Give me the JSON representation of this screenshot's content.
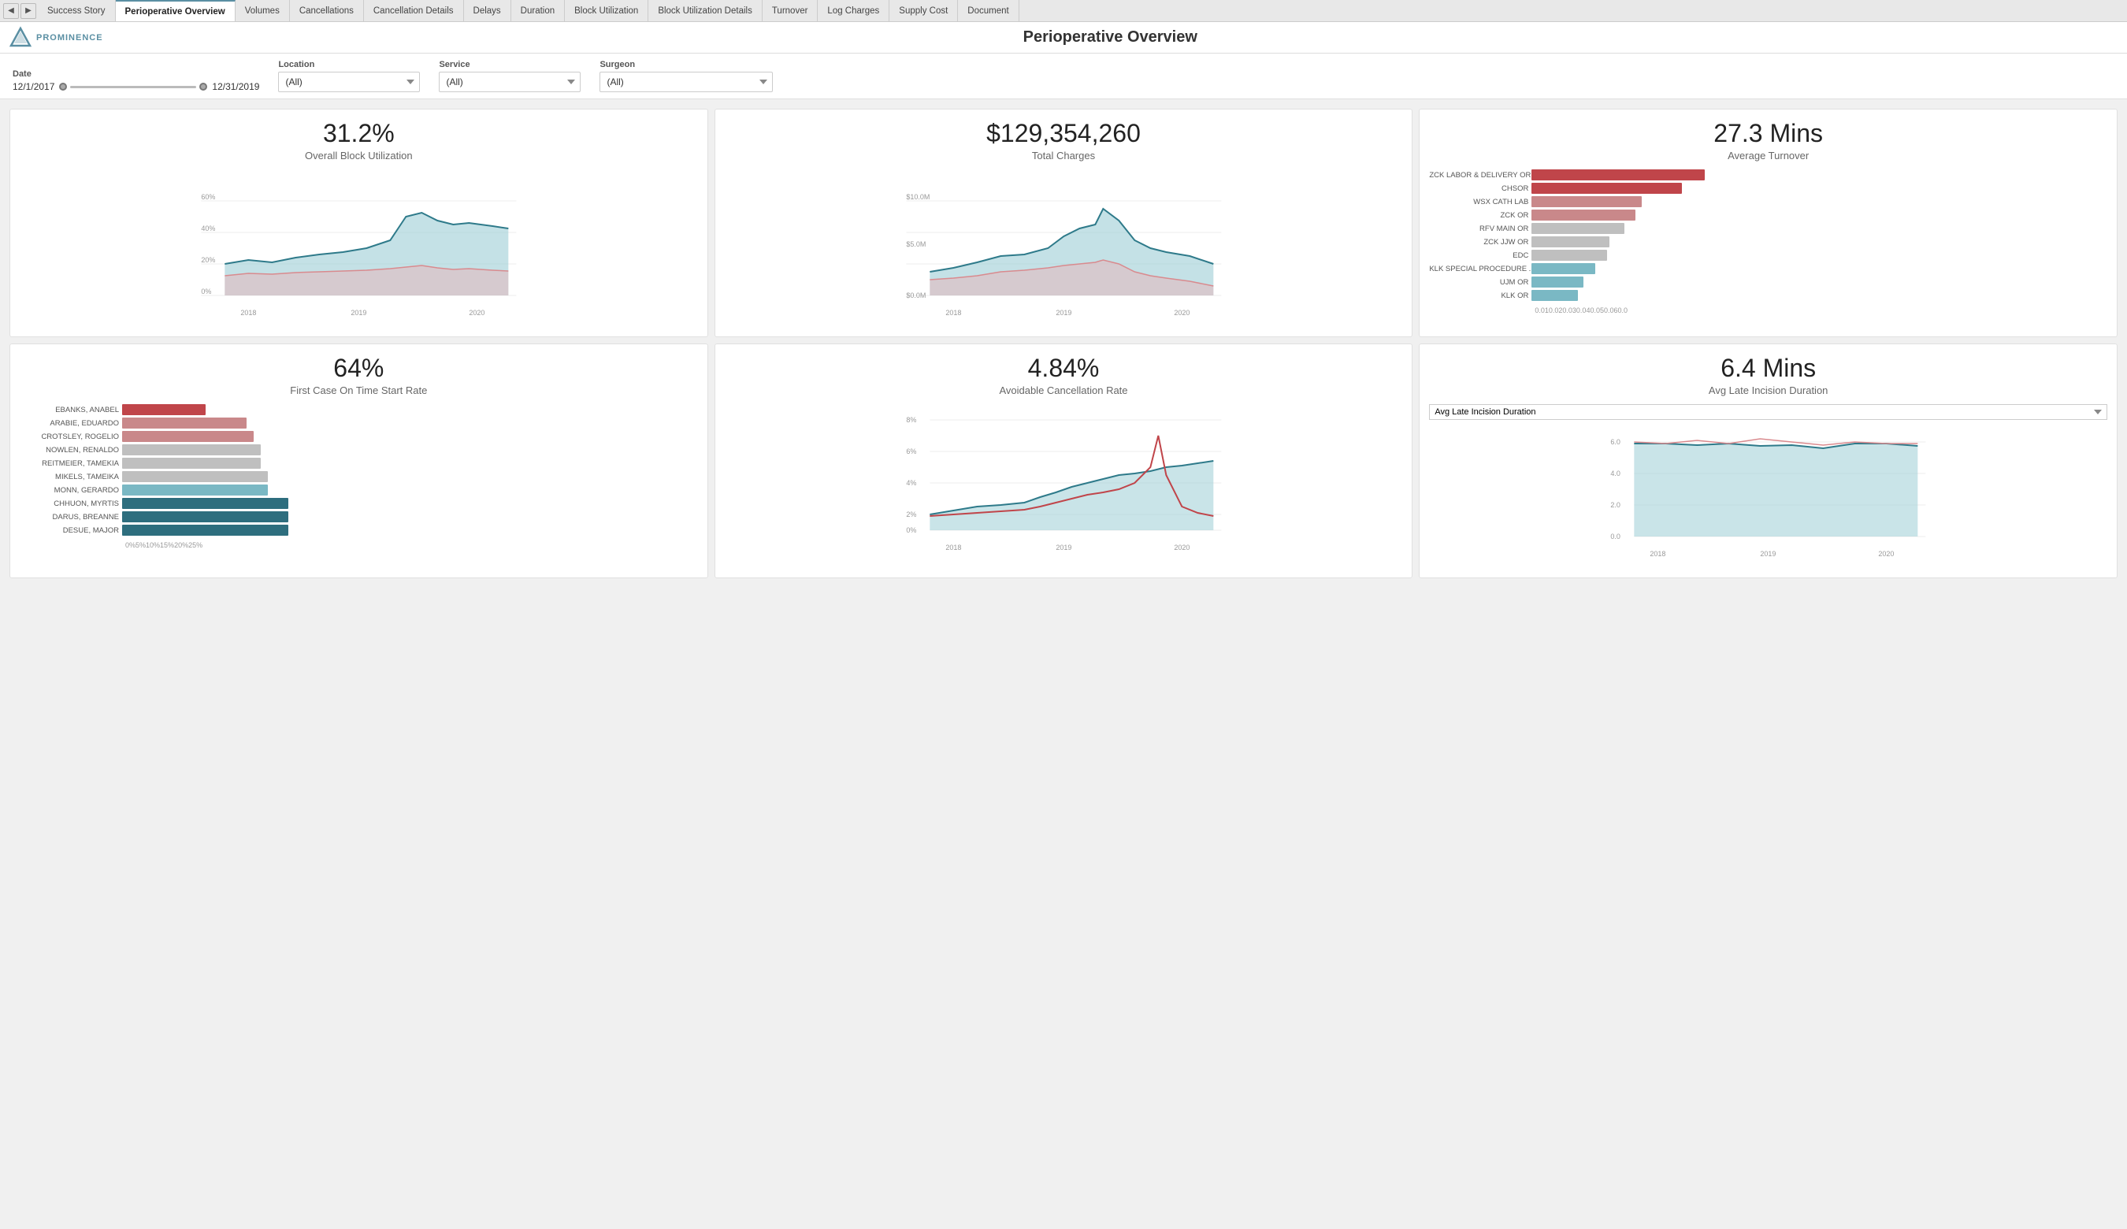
{
  "tabs": {
    "nav_prev": "<",
    "nav_next": ">",
    "items": [
      {
        "label": "Success Story",
        "active": false
      },
      {
        "label": "Perioperative Overview",
        "active": true
      },
      {
        "label": "Volumes",
        "active": false
      },
      {
        "label": "Cancellations",
        "active": false
      },
      {
        "label": "Cancellation Details",
        "active": false
      },
      {
        "label": "Delays",
        "active": false
      },
      {
        "label": "Duration",
        "active": false
      },
      {
        "label": "Block Utilization",
        "active": false
      },
      {
        "label": "Block Utilization Details",
        "active": false
      },
      {
        "label": "Turnover",
        "active": false
      },
      {
        "label": "Log Charges",
        "active": false
      },
      {
        "label": "Supply Cost",
        "active": false
      },
      {
        "label": "Document",
        "active": false
      }
    ]
  },
  "header": {
    "logo_text": "PROMINENCE",
    "title": "Perioperative Overview"
  },
  "filters": {
    "date_label": "Date",
    "date_start": "12/1/2017",
    "date_end": "12/31/2019",
    "location_label": "Location",
    "location_value": "(All)",
    "service_label": "Service",
    "service_value": "(All)",
    "surgeon_label": "Surgeon",
    "surgeon_value": "(All)"
  },
  "kpi1": {
    "value": "31.2%",
    "label": "Overall Block Utilization",
    "x_labels": [
      "2018",
      "2019",
      "2020"
    ]
  },
  "kpi2": {
    "value": "$129,354,260",
    "label": "Total Charges",
    "y_labels": [
      "$10.0M",
      "$5.0M",
      "$0.0M"
    ],
    "x_labels": [
      "2018",
      "2019",
      "2020"
    ]
  },
  "kpi3": {
    "value": "27.3 Mins",
    "label": "Average Turnover",
    "bars": [
      {
        "label": "ZCK LABOR & DELIVERY OR",
        "value": 60,
        "color": "#c0454a"
      },
      {
        "label": "CHSOR",
        "value": 52,
        "color": "#c0454a"
      },
      {
        "label": "WSX CATH LAB",
        "value": 38,
        "color": "#c9888a"
      },
      {
        "label": "ZCK OR",
        "value": 36,
        "color": "#c9888a"
      },
      {
        "label": "RFV MAIN OR",
        "value": 32,
        "color": "#bfbfbf"
      },
      {
        "label": "ZCK JJW OR",
        "value": 27,
        "color": "#bfbfbf"
      },
      {
        "label": "EDC",
        "value": 26,
        "color": "#bfbfbf"
      },
      {
        "label": "KLK SPECIAL PROCEDURE ...",
        "value": 22,
        "color": "#7ab8c4"
      },
      {
        "label": "UJM OR",
        "value": 18,
        "color": "#7ab8c4"
      },
      {
        "label": "KLK OR",
        "value": 16,
        "color": "#7ab8c4"
      }
    ],
    "x_labels": [
      "0.0",
      "10.0",
      "20.0",
      "30.0",
      "40.0",
      "50.0",
      "60.0"
    ],
    "max": 60
  },
  "kpi4": {
    "value": "64%",
    "label": "First Case On Time Start Rate",
    "bars": [
      {
        "label": "EBANKS, ANABEL",
        "value": 12,
        "color": "#c0454a"
      },
      {
        "label": "ARABIE, EDUARDO",
        "value": 18,
        "color": "#c9888a"
      },
      {
        "label": "CROTSLEY, ROGELIO",
        "value": 19,
        "color": "#c9888a"
      },
      {
        "label": "NOWLEN, RENALDO",
        "value": 20,
        "color": "#bfbfbf"
      },
      {
        "label": "REITMEIER, TAMEKIA",
        "value": 20,
        "color": "#bfbfbf"
      },
      {
        "label": "MIKELS, TAMEIKA",
        "value": 21,
        "color": "#bfbfbf"
      },
      {
        "label": "MONN, GERARDO",
        "value": 21,
        "color": "#7ab8c4"
      },
      {
        "label": "CHHUON, MYRTIS",
        "value": 24,
        "color": "#2e6e7e"
      },
      {
        "label": "DARUS, BREANNE",
        "value": 24,
        "color": "#2e6e7e"
      },
      {
        "label": "DESUE, MAJOR",
        "value": 24,
        "color": "#2e6e7e"
      }
    ],
    "x_labels": [
      "0%",
      "5%",
      "10%",
      "15%",
      "20%",
      "25%"
    ],
    "max": 25
  },
  "kpi5": {
    "value": "4.84%",
    "label": "Avoidable Cancellation Rate",
    "y_labels": [
      "8%",
      "6%",
      "4%",
      "2%",
      "0%"
    ],
    "x_labels": [
      "2018",
      "2019",
      "2020"
    ]
  },
  "kpi6": {
    "value": "6.4 Mins",
    "label": "Avg Late Incision Duration",
    "dropdown_value": "Avg Late Incision Duration",
    "y_labels": [
      "6.0",
      "4.0",
      "2.0",
      "0.0"
    ],
    "x_labels": [
      "2018",
      "2019",
      "2020"
    ]
  }
}
